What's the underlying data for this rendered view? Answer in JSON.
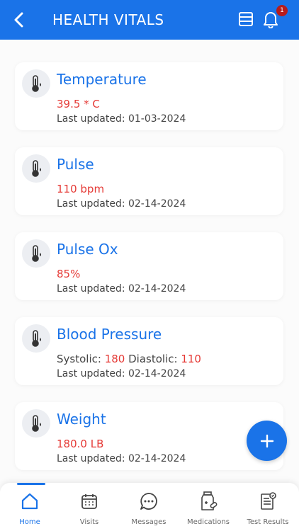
{
  "header": {
    "title": "HEALTH VITALS",
    "notification_count": "1"
  },
  "vitals": [
    {
      "name": "Temperature",
      "value": "39.5 * C",
      "updated": "Last updated: 01-03-2024"
    },
    {
      "name": "Pulse",
      "value": "110 bpm",
      "updated": "Last updated: 02-14-2024"
    },
    {
      "name": "Pulse Ox",
      "value": "85%",
      "updated": "Last updated: 02-14-2024"
    },
    {
      "name": "Blood Pressure",
      "systolic_label": "Systolic:",
      "systolic_value": "180",
      "diastolic_label": "Diastolic:",
      "diastolic_value": "110",
      "updated": "Last updated: 02-14-2024"
    },
    {
      "name": "Weight",
      "value": "180.0 LB",
      "updated": "Last updated: 02-14-2024"
    }
  ],
  "nav": {
    "items": [
      {
        "label": "Home",
        "icon": "home-icon"
      },
      {
        "label": "Visits",
        "icon": "calendar-icon"
      },
      {
        "label": "Messages",
        "icon": "chat-icon"
      },
      {
        "label": "Medications",
        "icon": "medication-icon"
      },
      {
        "label": "Test Results",
        "icon": "test-results-icon"
      }
    ],
    "active": "Home"
  },
  "colors": {
    "primary": "#1a73e8",
    "alert": "#e53935"
  }
}
